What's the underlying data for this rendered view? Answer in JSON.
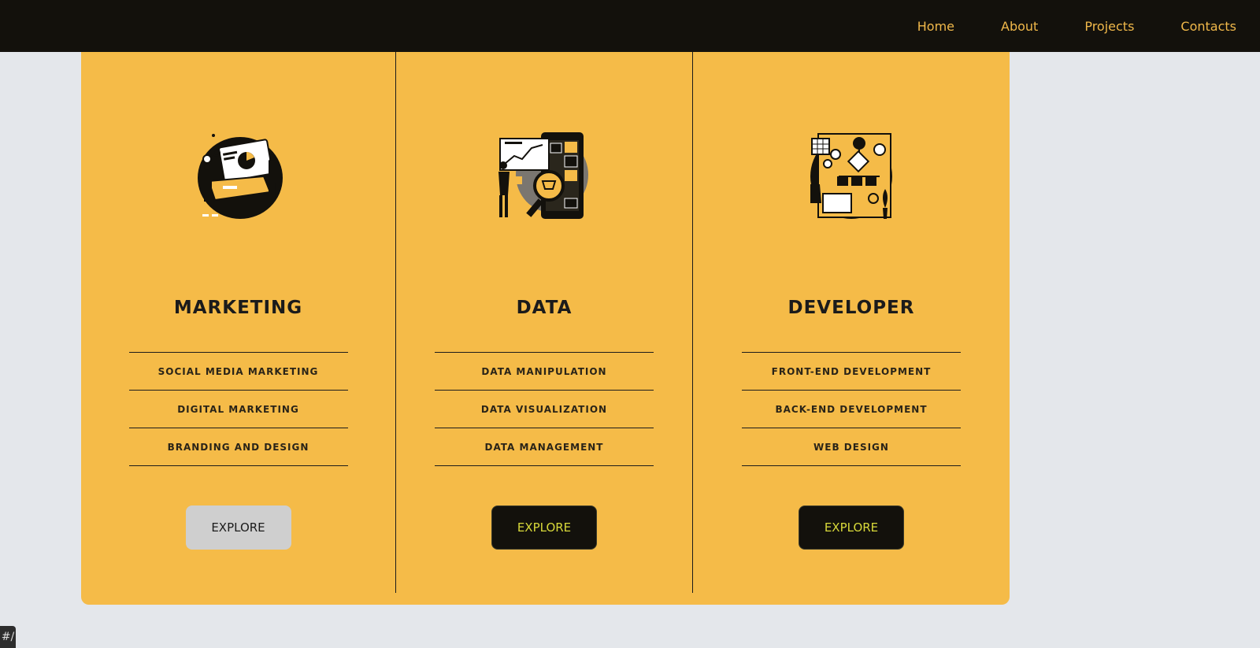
{
  "nav": {
    "links": [
      "Home",
      "About",
      "Projects",
      "Contacts"
    ]
  },
  "colors": {
    "nav_bg": "#13110c",
    "nav_link": "#f0b84a",
    "card_bg": "#f5bb48",
    "page_bg": "#e4e7eb",
    "button_dark": "#13110c",
    "button_dark_text": "#d8d93a",
    "button_light": "#cfcfcf"
  },
  "columns": [
    {
      "title": "MARKETING",
      "illustration": "marketing-illustration",
      "skills": [
        "SOCIAL MEDIA MARKETING",
        "DIGITAL MARKETING",
        "BRANDING AND DESIGN"
      ],
      "button": "EXPLORE"
    },
    {
      "title": "DATA",
      "illustration": "data-illustration",
      "skills": [
        "DATA MANIPULATION",
        "DATA VISUALIZATION",
        "DATA MANAGEMENT"
      ],
      "button": "EXPLORE"
    },
    {
      "title": "DEVELOPER",
      "illustration": "developer-illustration",
      "skills": [
        "FRONT-END DEVELOPMENT",
        "BACK-END DEVELOPMENT",
        "WEB DESIGN"
      ],
      "button": "EXPLORE"
    }
  ],
  "corner_tab": "#/"
}
